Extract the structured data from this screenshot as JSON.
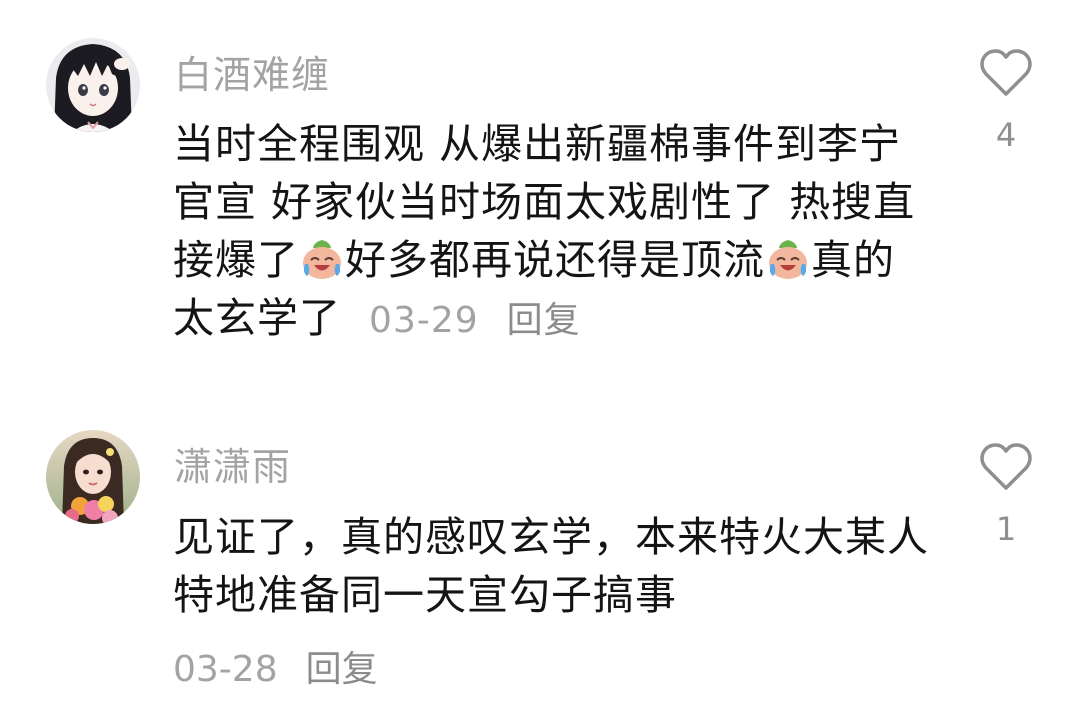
{
  "comments": [
    {
      "username": "白酒难缠",
      "text_a": "当时全程围观 从爆出新疆棉事件到李宁官宣 好家伙当时场面太戏剧性了  热搜直接爆了",
      "text_b": "好多都再说还得是顶流",
      "text_c": "真的太玄学了",
      "emoji": "crying-laughing-peach-emoji",
      "date": "03-29",
      "reply_label": "回复",
      "likes": "4",
      "like_icon": "heart-outline-icon",
      "avatar": "anime-girl-avatar"
    },
    {
      "username": "潇潇雨",
      "text": "见证了，真的感叹玄学，本来特火大某人特地准备同一天宣勾子搞事",
      "date": "03-28",
      "reply_label": "回复",
      "likes": "1",
      "like_icon": "heart-outline-icon",
      "avatar": "girl-with-flowers-avatar"
    }
  ],
  "colors": {
    "username": "#a3a3a3",
    "text": "#141414",
    "meta": "#a3a3a3",
    "icon": "#8f8f8f"
  }
}
